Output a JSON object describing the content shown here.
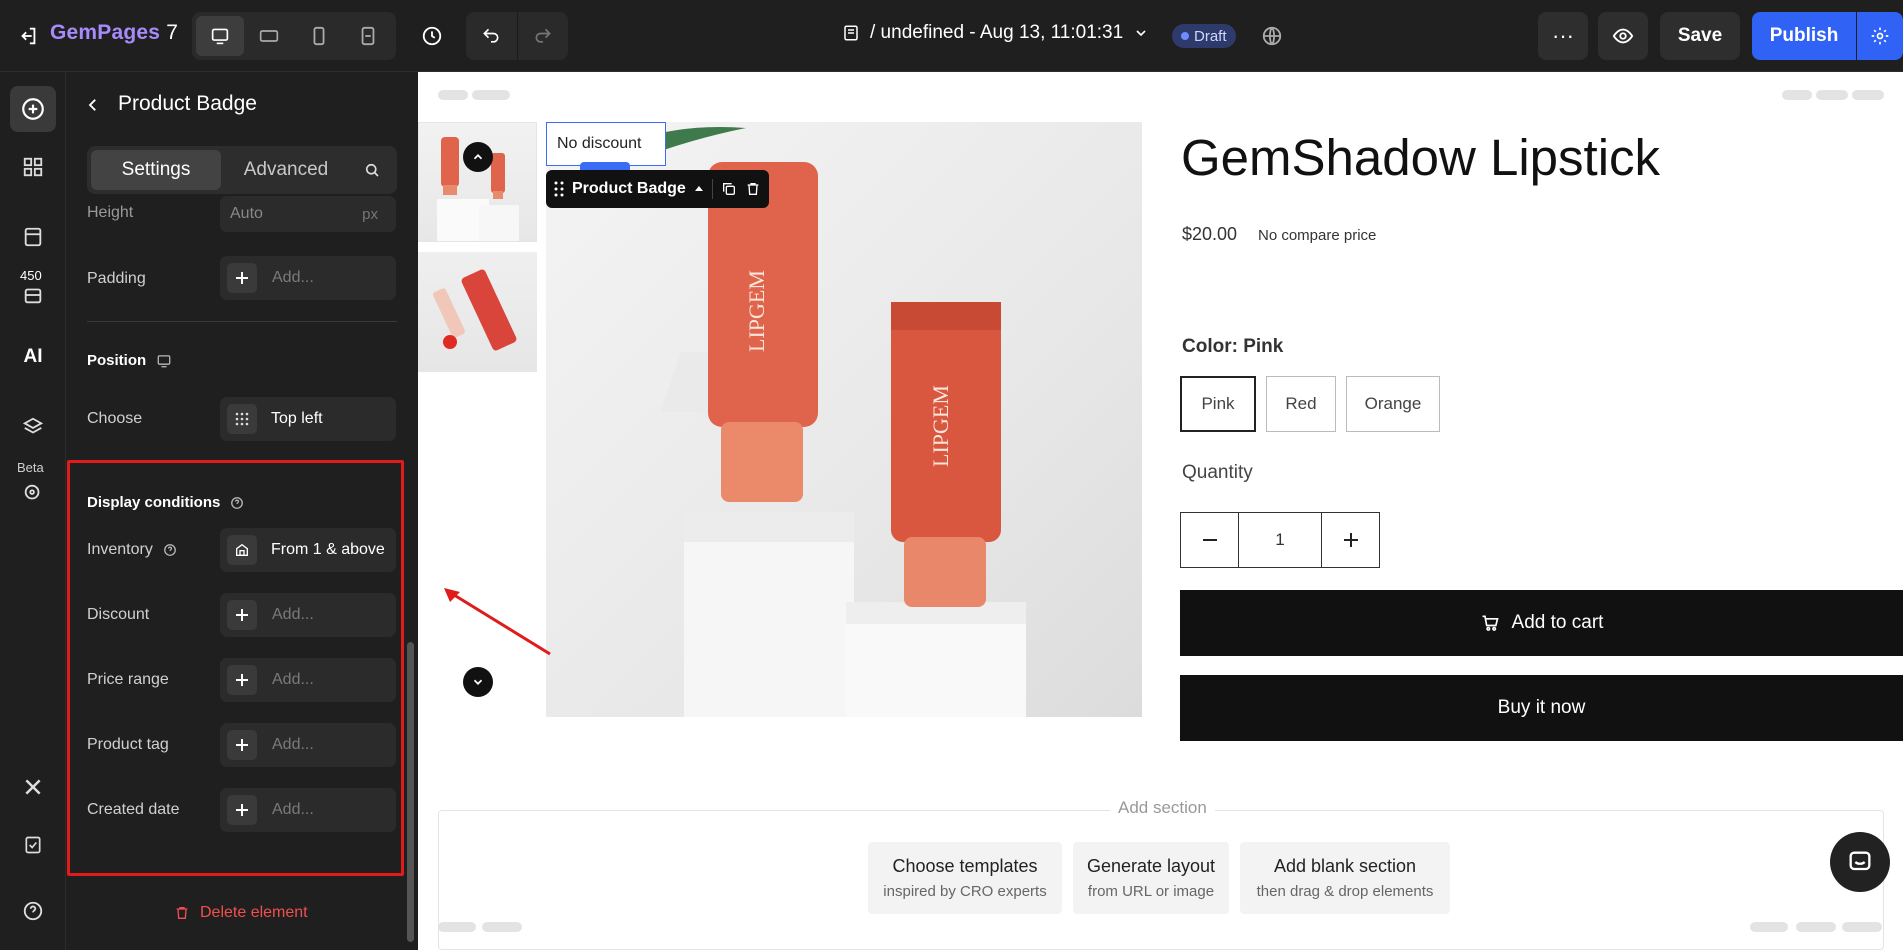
{
  "topbar": {
    "brand_name": "GemPages",
    "brand_version": "7",
    "page_title": "/ undefined - Aug 13, 11:01:31",
    "status": "Draft",
    "save_label": "Save",
    "publish_label": "Publish",
    "more_label": "···"
  },
  "rail": {
    "count_badge": "450",
    "ai_label": "AI",
    "beta_label": "Beta"
  },
  "panel": {
    "title": "Product Badge",
    "tabs": {
      "settings": "Settings",
      "advanced": "Advanced"
    },
    "height": {
      "label": "Height",
      "value": "Auto",
      "unit": "px"
    },
    "padding": {
      "label": "Padding",
      "placeholder": "Add..."
    },
    "position": {
      "heading": "Position",
      "choose_label": "Choose",
      "choose_value": "Top left"
    },
    "display_conditions": {
      "heading": "Display conditions",
      "inventory": {
        "label": "Inventory",
        "value": "From 1 & above"
      },
      "discount": {
        "label": "Discount",
        "placeholder": "Add..."
      },
      "price_range": {
        "label": "Price range",
        "placeholder": "Add..."
      },
      "product_tag": {
        "label": "Product tag",
        "placeholder": "Add..."
      },
      "created_date": {
        "label": "Created date",
        "placeholder": "Add..."
      }
    },
    "delete_label": "Delete element"
  },
  "canvas": {
    "badge_text": "No discount",
    "badge_toolbar_label": "Product Badge",
    "product_title": "GemShadow Lipstick",
    "price": "$20.00",
    "compare_price": "No compare price",
    "color_label": "Color:",
    "color_value": "Pink",
    "colors": [
      "Pink",
      "Red",
      "Orange"
    ],
    "quantity_label": "Quantity",
    "quantity_value": "1",
    "add_to_cart": "Add to cart",
    "buy_now": "Buy it now",
    "add_section": "Add section",
    "options": [
      {
        "title": "Choose templates",
        "subtitle": "inspired by CRO experts"
      },
      {
        "title": "Generate layout",
        "subtitle": "from URL or image"
      },
      {
        "title": "Add blank section",
        "subtitle": "then drag & drop elements"
      }
    ],
    "tube_brand": "LIPGEM"
  },
  "colors": {
    "accent_blue": "#2f62f5",
    "highlight_red": "#e01b1b",
    "delete_red": "#f0504d",
    "product_orange": "#e0634b"
  }
}
